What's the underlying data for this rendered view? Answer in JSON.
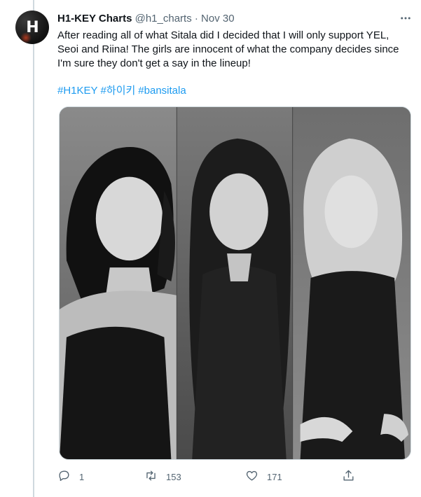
{
  "tweet": {
    "display_name": "H1-KEY Charts",
    "handle": "@h1_charts",
    "separator": "·",
    "time": "Nov 30",
    "avatar_text": "H",
    "text_lines": [
      "After reading all of what Sitala did I decided that I will only support YEL,",
      "Seoi and Riina! The girls are innocent of what the company decides since",
      "I'm sure they don't get a say in the lineup!"
    ],
    "hashtags": [
      "#H1KEY",
      "#하이키",
      "#bansitala"
    ]
  },
  "actions": {
    "reply_count": "1",
    "retweet_count": "153",
    "like_count": "171"
  },
  "colors": {
    "link": "#1d9bf0",
    "muted": "#536471",
    "text": "#0f1419",
    "border": "#cfd9de"
  }
}
